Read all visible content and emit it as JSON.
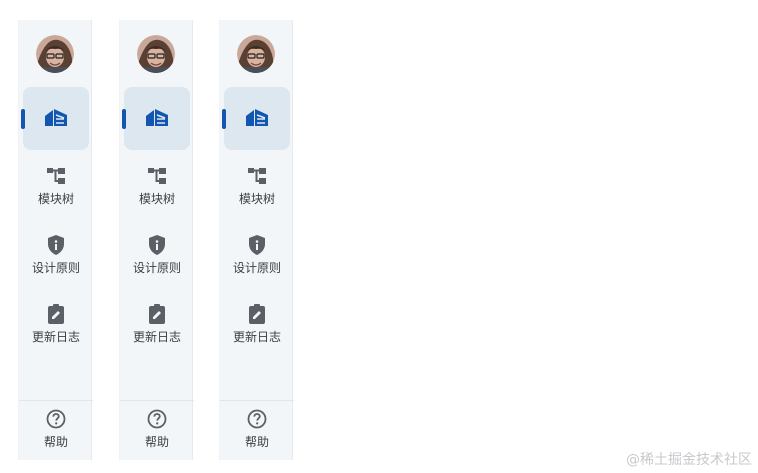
{
  "nav": {
    "items": [
      {
        "label": "模块树",
        "icon": "module-tree-icon"
      },
      {
        "label": "设计原则",
        "icon": "shield-info-icon"
      },
      {
        "label": "更新日志",
        "icon": "clipboard-edit-icon"
      }
    ],
    "help": {
      "label": "帮助",
      "icon": "help-circle-icon"
    }
  },
  "active_item_icon": "home-icon",
  "watermark": "@稀土掘金技术社区",
  "colors": {
    "rail_background": "#f3f6f9",
    "active_background": "#dde7ef",
    "accent": "#1256b0",
    "icon": "#5b5f66",
    "label": "#3c4043"
  }
}
